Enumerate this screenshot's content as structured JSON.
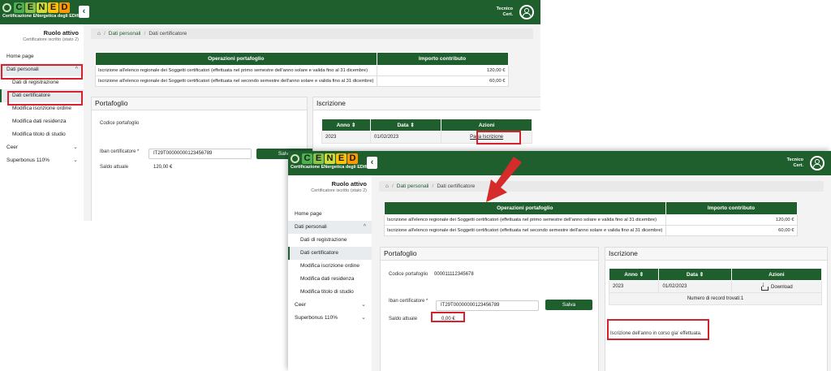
{
  "colors": {
    "brand_green": "#1f5f2e",
    "highlight_red": "#d4232e",
    "arrow_red": "#d62b2b"
  },
  "logo": {
    "letters": [
      {
        "char": "C",
        "color": "#4caf50"
      },
      {
        "char": "E",
        "color": "#8bc34a"
      },
      {
        "char": "N",
        "color": "#cddc39"
      },
      {
        "char": "E",
        "color": "#ffc107"
      },
      {
        "char": "D",
        "color": "#ff9800"
      }
    ],
    "subtitle": "Certificazione ENergetica degli EDifici",
    "icons": [
      "collapse-sidebar-icon",
      "user-account-icon"
    ]
  },
  "user": {
    "line1": "Tecnico",
    "line2": "Cert."
  },
  "role": {
    "title": "Ruolo attivo",
    "subtitle": "Certificatore iscritto (stato 2)"
  },
  "nav": {
    "home": "Home page",
    "dati_personali": "Dati personali",
    "dati_registrazione": "Dati di registrazione",
    "dati_certificatore": "Dati certificatore",
    "modifica_iscrizione": "Modifica iscrizione ordine",
    "modifica_residenza": "Modifica dati residenza",
    "modifica_titolo": "Modifica titolo di studio",
    "ceer": "Ceer",
    "superbonus": "Superbonus 110%"
  },
  "breadcrumb": {
    "home_icon": "home-icon",
    "level1": "Dati personali",
    "level2": "Dati certificatore"
  },
  "operazioni": {
    "header_desc": "Operazioni portafoglio",
    "header_amount": "Importo contributo",
    "rows": [
      {
        "desc": "Iscrizione all'elenco regionale dei Soggetti certificatori (effettuata nel primo semestre dell'anno solare e valida fino al 31 dicembre)",
        "amount": "120,00 €"
      },
      {
        "desc": "Iscrizione all'elenco regionale dei Soggetti certificatori (effettuata nel secondo semestre dell'anno solare e valida fino al 31 dicembre)",
        "amount": "60,00 €"
      }
    ]
  },
  "portafoglio": {
    "title": "Portafoglio",
    "codice_label": "Codice portafoglio",
    "codice_value_after": "000011112345678",
    "iban_label": "Iban certificatore",
    "iban_required": "*",
    "iban_value": "IT29T00000000123456789",
    "save_label": "Salva",
    "saldo_label": "Saldo attuale",
    "saldo_before": "120,00 €",
    "saldo_after": "0,00 €"
  },
  "iscrizione": {
    "title": "Iscrizione",
    "col_anno": "Anno",
    "col_data": "Data",
    "col_azioni": "Azioni",
    "sort_icon": "sort-icon",
    "anno": "2023",
    "data": "01/02/2023",
    "paga_label": "Paga Iscrizione",
    "download_label": "Download",
    "records_found": "Numero di record trovati:1",
    "effettuata_msg": "Iscrizione dell'anno in corso gia' effettuata."
  }
}
